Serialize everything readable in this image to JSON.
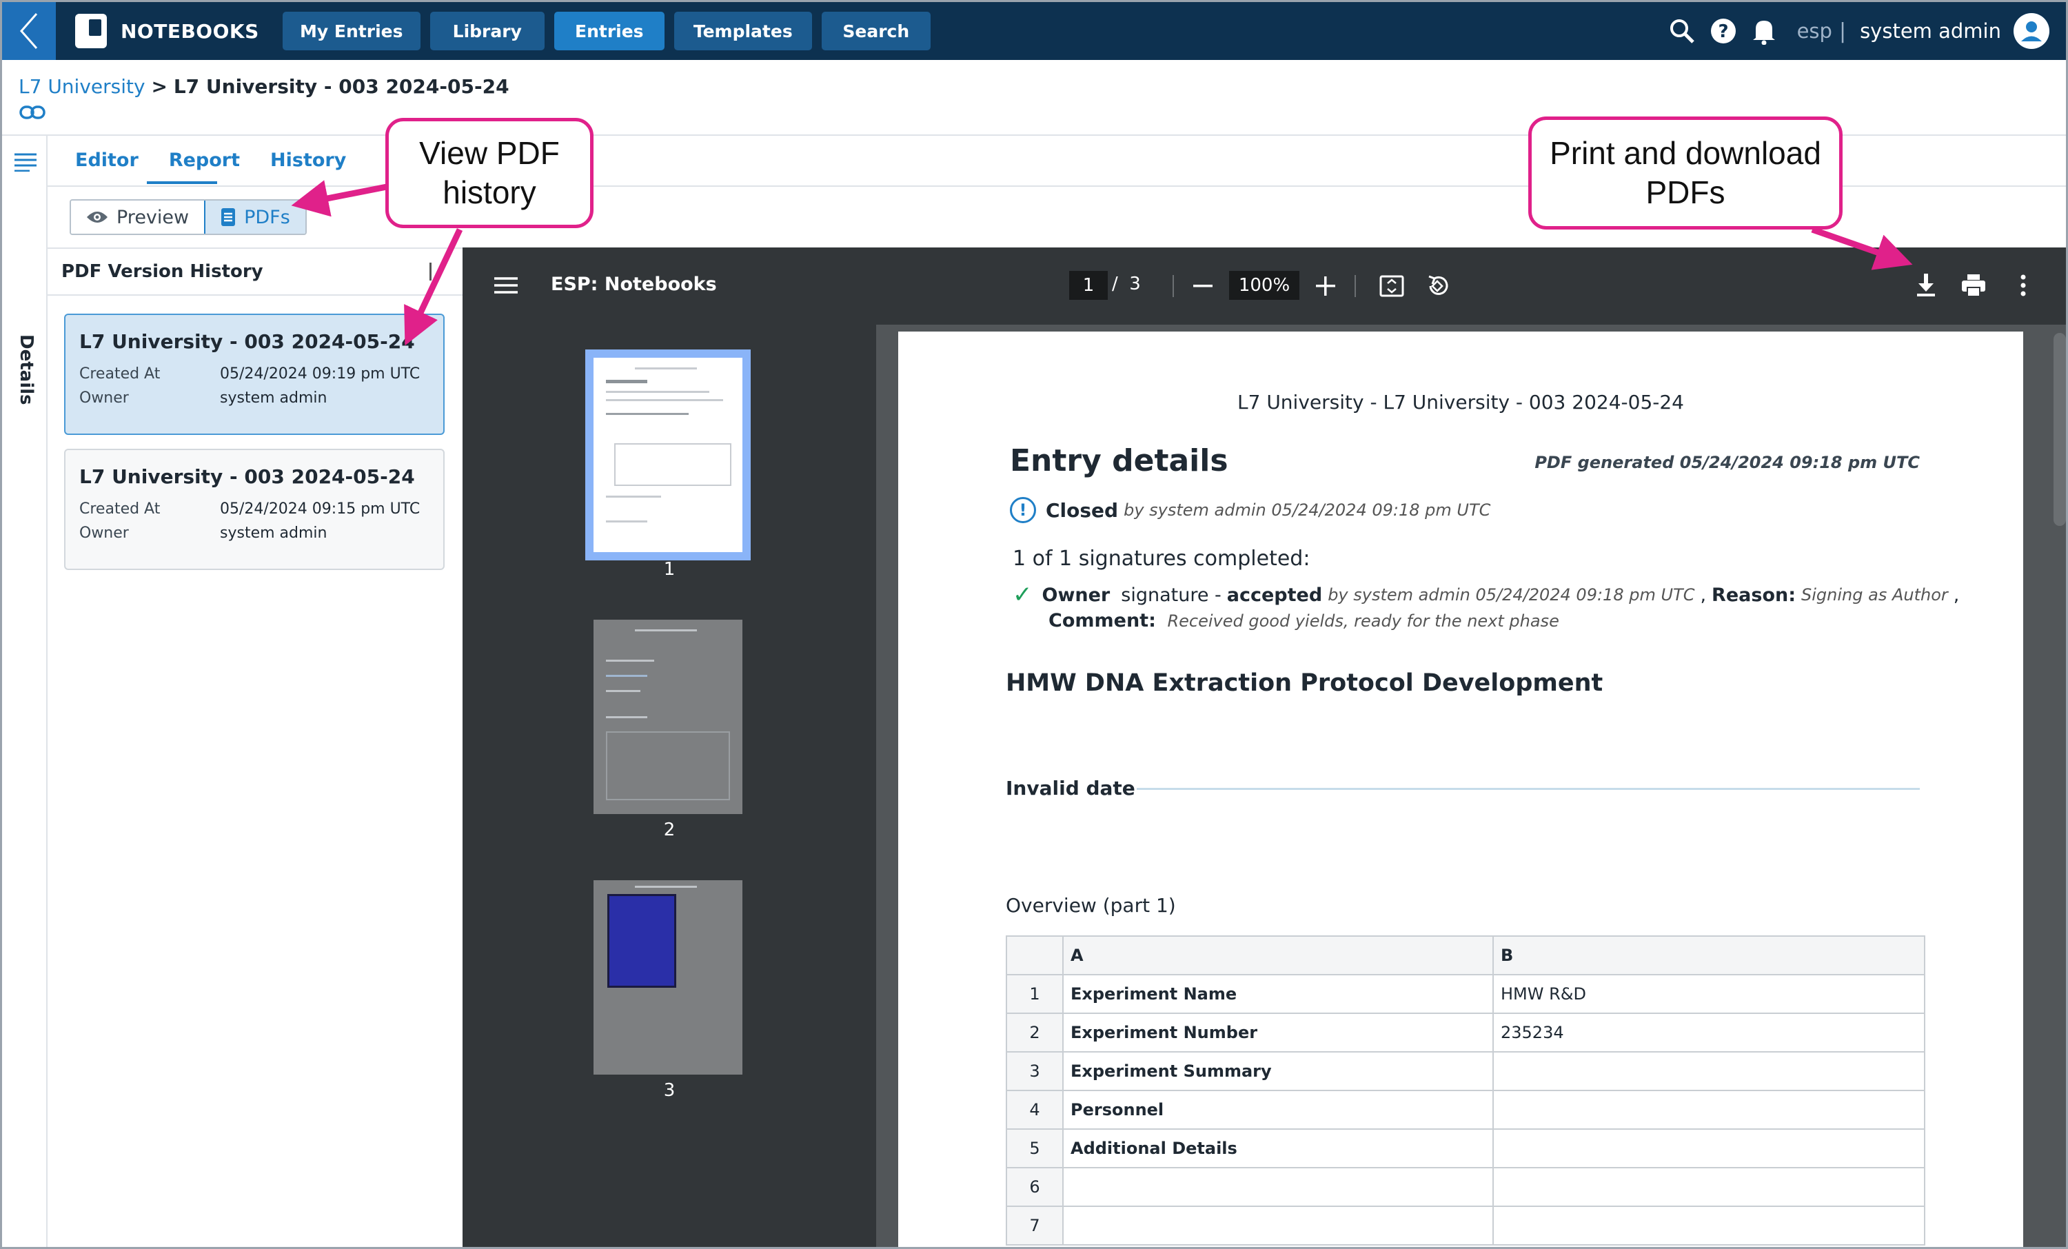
{
  "nav": {
    "brand": "NOTEBOOKS",
    "items": [
      {
        "label": "My Entries",
        "active": false
      },
      {
        "label": "Library",
        "active": false
      },
      {
        "label": "Entries",
        "active": true
      },
      {
        "label": "Templates",
        "active": false
      },
      {
        "label": "Search",
        "active": false
      }
    ],
    "workspace": "esp",
    "separator": "|",
    "user": "system admin"
  },
  "breadcrumb": {
    "parent": "L7 University",
    "separator": ">",
    "current": "L7 University - 003 2024-05-24"
  },
  "rail": {
    "details_label": "Details"
  },
  "tabs": [
    "Editor",
    "Report",
    "History"
  ],
  "view_toggle": {
    "preview": "Preview",
    "pdfs": "PDFs",
    "selected": "PDFs"
  },
  "history": {
    "title": "PDF Version History",
    "entries": [
      {
        "title": "L7 University - 003 2024-05-24",
        "created_key": "Created At",
        "created": "05/24/2024 09:19 pm UTC",
        "owner_key": "Owner",
        "owner": "system admin",
        "selected": true
      },
      {
        "title": "L7 University - 003 2024-05-24",
        "created_key": "Created At",
        "created": "05/24/2024 09:15 pm UTC",
        "owner_key": "Owner",
        "owner": "system admin",
        "selected": false
      }
    ]
  },
  "viewer": {
    "title": "ESP: Notebooks",
    "current_page": "1",
    "page_sep": "/",
    "total_pages": "3",
    "zoom": "100%",
    "thumbnails": [
      "1",
      "2",
      "3"
    ]
  },
  "pdf": {
    "header": "L7 University - L7 University - 003 2024-05-24",
    "title": "Entry details",
    "generated": "PDF generated 05/24/2024 09:18 pm UTC",
    "status_label": "Closed",
    "status_meta": "by system admin 05/24/2024 09:18 pm UTC",
    "signatures_summary": "1 of 1 signatures completed:",
    "sig_role": "Owner",
    "sig_text": "signature -",
    "sig_state": "accepted",
    "sig_meta": "by system admin 05/24/2024 09:18 pm UTC",
    "sig_comma": ",",
    "reason_label": "Reason:",
    "reason": "Signing as Author",
    "comment_label": "Comment:",
    "comment": "Received good yields, ready for the next phase",
    "section_title": "HMW DNA Extraction Protocol Development",
    "date_label": "Invalid date",
    "overview_title": "Overview (part 1)",
    "table": {
      "headers": [
        "",
        "A",
        "B"
      ],
      "rows": [
        [
          "1",
          "Experiment Name",
          "HMW R&D"
        ],
        [
          "2",
          "Experiment Number",
          "235234"
        ],
        [
          "3",
          "Experiment Summary",
          ""
        ],
        [
          "4",
          "Personnel",
          ""
        ],
        [
          "5",
          "Additional Details",
          ""
        ],
        [
          "6",
          "",
          ""
        ],
        [
          "7",
          "",
          ""
        ]
      ]
    }
  },
  "callouts": {
    "history": "View PDF history",
    "download": "Print and download PDFs"
  },
  "colors": {
    "topbar": "#0d3150",
    "accent": "#1f7fc7",
    "callout_border": "#e0218a",
    "accepted_check": "#1e9e5a"
  }
}
